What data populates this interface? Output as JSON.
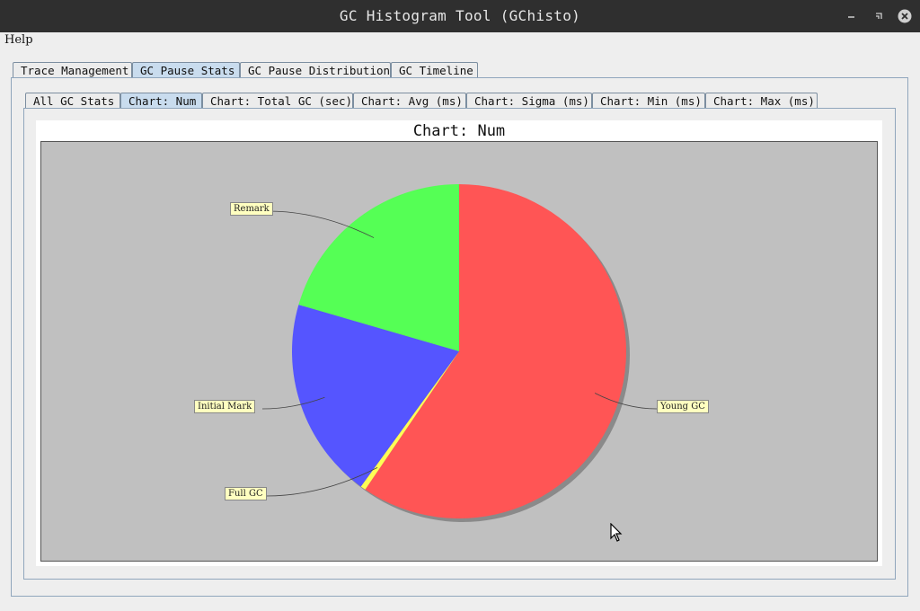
{
  "window": {
    "title": "GC Histogram Tool (GChisto)",
    "controls": [
      "minimize-icon",
      "restore-icon",
      "close-icon"
    ]
  },
  "menu": {
    "help": "Help"
  },
  "main_tabs": [
    {
      "label": "Trace Management",
      "selected": false
    },
    {
      "label": "GC Pause Stats",
      "selected": true
    },
    {
      "label": "GC Pause Distribution",
      "selected": false
    },
    {
      "label": "GC Timeline",
      "selected": false
    }
  ],
  "sub_tabs": [
    {
      "label": "All GC Stats",
      "selected": false
    },
    {
      "label": "Chart: Num",
      "selected": true
    },
    {
      "label": "Chart: Total GC (sec)",
      "selected": false
    },
    {
      "label": "Chart: Avg (ms)",
      "selected": false
    },
    {
      "label": "Chart: Sigma (ms)",
      "selected": false
    },
    {
      "label": "Chart: Min (ms)",
      "selected": false
    },
    {
      "label": "Chart: Max (ms)",
      "selected": false
    }
  ],
  "chart_data": {
    "type": "pie",
    "title": "Chart: Num",
    "categories": [
      "Young GC",
      "Full GC",
      "Initial Mark",
      "Remark"
    ],
    "values": [
      59.5,
      0.5,
      19.5,
      20.5
    ],
    "colors": [
      "#ff5555",
      "#ffff55",
      "#5555ff",
      "#55ff55"
    ],
    "background": "#c0c0c0",
    "label_background": "#ffffc0"
  }
}
